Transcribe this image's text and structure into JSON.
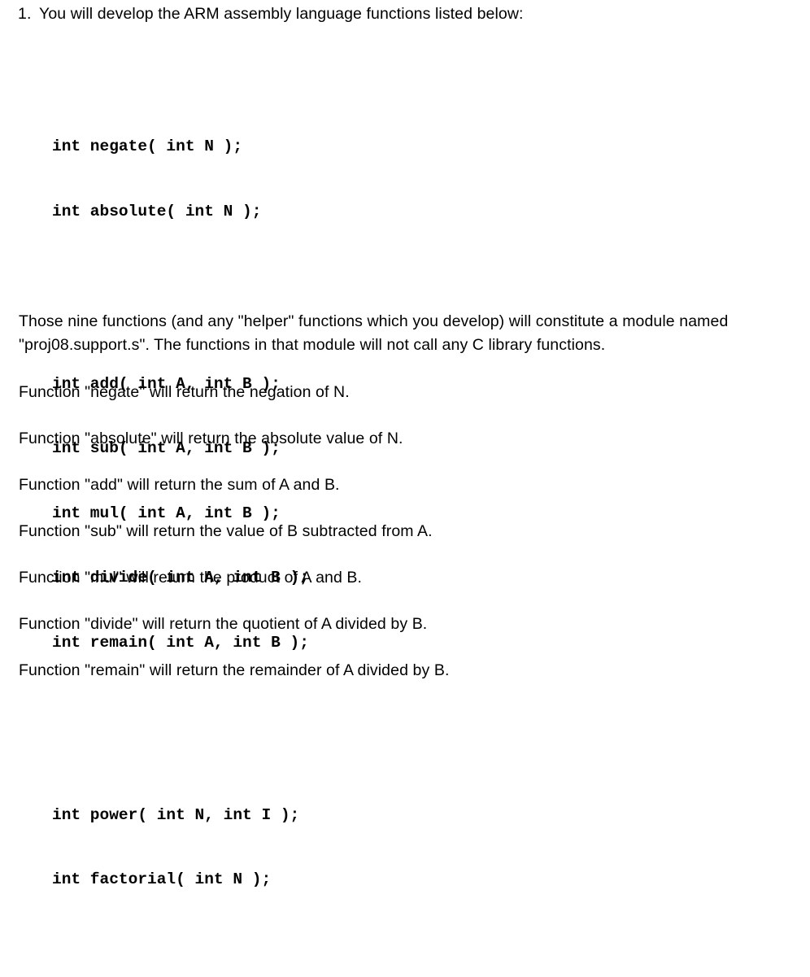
{
  "document": {
    "list_item": {
      "marker": "1.",
      "text": "You will develop the ARM assembly language functions listed below:"
    },
    "code_block": {
      "groups": [
        {
          "lines": [
            "int negate( int N );",
            "int absolute( int N );"
          ]
        },
        {
          "lines": [
            "int add( int A, int B );",
            "int sub( int A, int B );",
            "int mul( int A, int B );",
            "int divide( int A, int B );",
            "int remain( int A, int B );"
          ]
        },
        {
          "lines": [
            "int power( int N, int I );",
            "int factorial( int N );"
          ]
        }
      ]
    },
    "paragraphs": {
      "module": {
        "line1": "Those nine functions (and any \"helper\" functions which you develop) will constitute a module named",
        "line2": "\"proj08.support.s\".  The functions in that module will not call any C library functions."
      },
      "negate": "Function \"negate\" will return the negation of N.",
      "absolute": "Function \"absolute\" will return the absolute value of N.",
      "add": "Function \"add\" will return the sum of A and B.",
      "sub": "Function \"sub\" will return the value of B subtracted from A.",
      "mul": "Function \"mul\" will return the product of A and B.",
      "divide": "Function \"divide\" will return the quotient of A divided by B.",
      "remain": "Function \"remain\" will return the remainder of A divided by B."
    }
  }
}
